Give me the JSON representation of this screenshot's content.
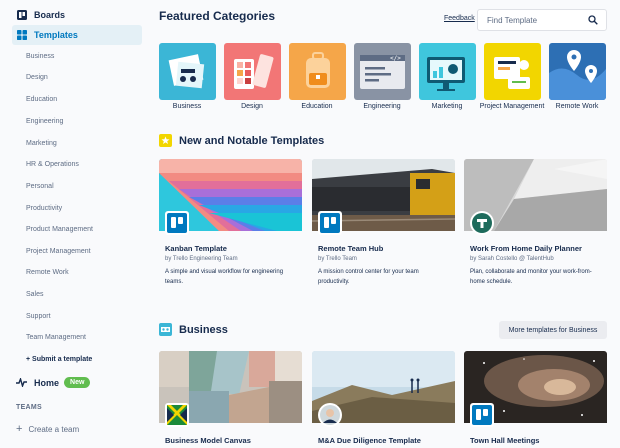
{
  "sidebar": {
    "boards_label": "Boards",
    "templates_label": "Templates",
    "categories": [
      "Business",
      "Design",
      "Education",
      "Engineering",
      "Marketing",
      "HR & Operations",
      "Personal",
      "Productivity",
      "Product Management",
      "Project Management",
      "Remote Work",
      "Sales",
      "Support",
      "Team Management"
    ],
    "submit_label": "+ Submit a template",
    "home_label": "Home",
    "home_badge": "New",
    "teams_label": "TEAMS",
    "create_team_label": "Create a team"
  },
  "header": {
    "title": "Featured Categories",
    "feedback_label": "Feedback",
    "search_placeholder": "Find Template"
  },
  "featured": [
    {
      "label": "Business",
      "color": "#3bb6d6"
    },
    {
      "label": "Design",
      "color": "#f27676"
    },
    {
      "label": "Education",
      "color": "#f5a649"
    },
    {
      "label": "Engineering",
      "color": "#8993a4"
    },
    {
      "label": "Marketing",
      "color": "#3fc6dd"
    },
    {
      "label": "Project Management",
      "color": "#f2d600"
    },
    {
      "label": "Remote Work",
      "color": "#2d6fb4"
    }
  ],
  "new_notable": {
    "heading": "New and Notable Templates",
    "cards": [
      {
        "title": "Kanban Template",
        "by": "by Trello Engineering Team",
        "desc": "A simple and visual workflow for engineering teams."
      },
      {
        "title": "Remote Team Hub",
        "by": "by Trello Team",
        "desc": "A mission control center for your team productivity."
      },
      {
        "title": "Work From Home Daily Planner",
        "by": "by Sarah Costello @ TalentHub",
        "desc": "Plan, collaborate and monitor your work-from-home schedule."
      }
    ]
  },
  "business": {
    "heading": "Business",
    "more_label": "More templates for Business",
    "cards": [
      {
        "title": "Business Model Canvas"
      },
      {
        "title": "M&A Due Diligence Template"
      },
      {
        "title": "Town Hall Meetings"
      }
    ]
  },
  "colors": {
    "accent": "#0079bf",
    "active_bg": "#e4f0f6",
    "new_badge": "#61bd4f"
  }
}
